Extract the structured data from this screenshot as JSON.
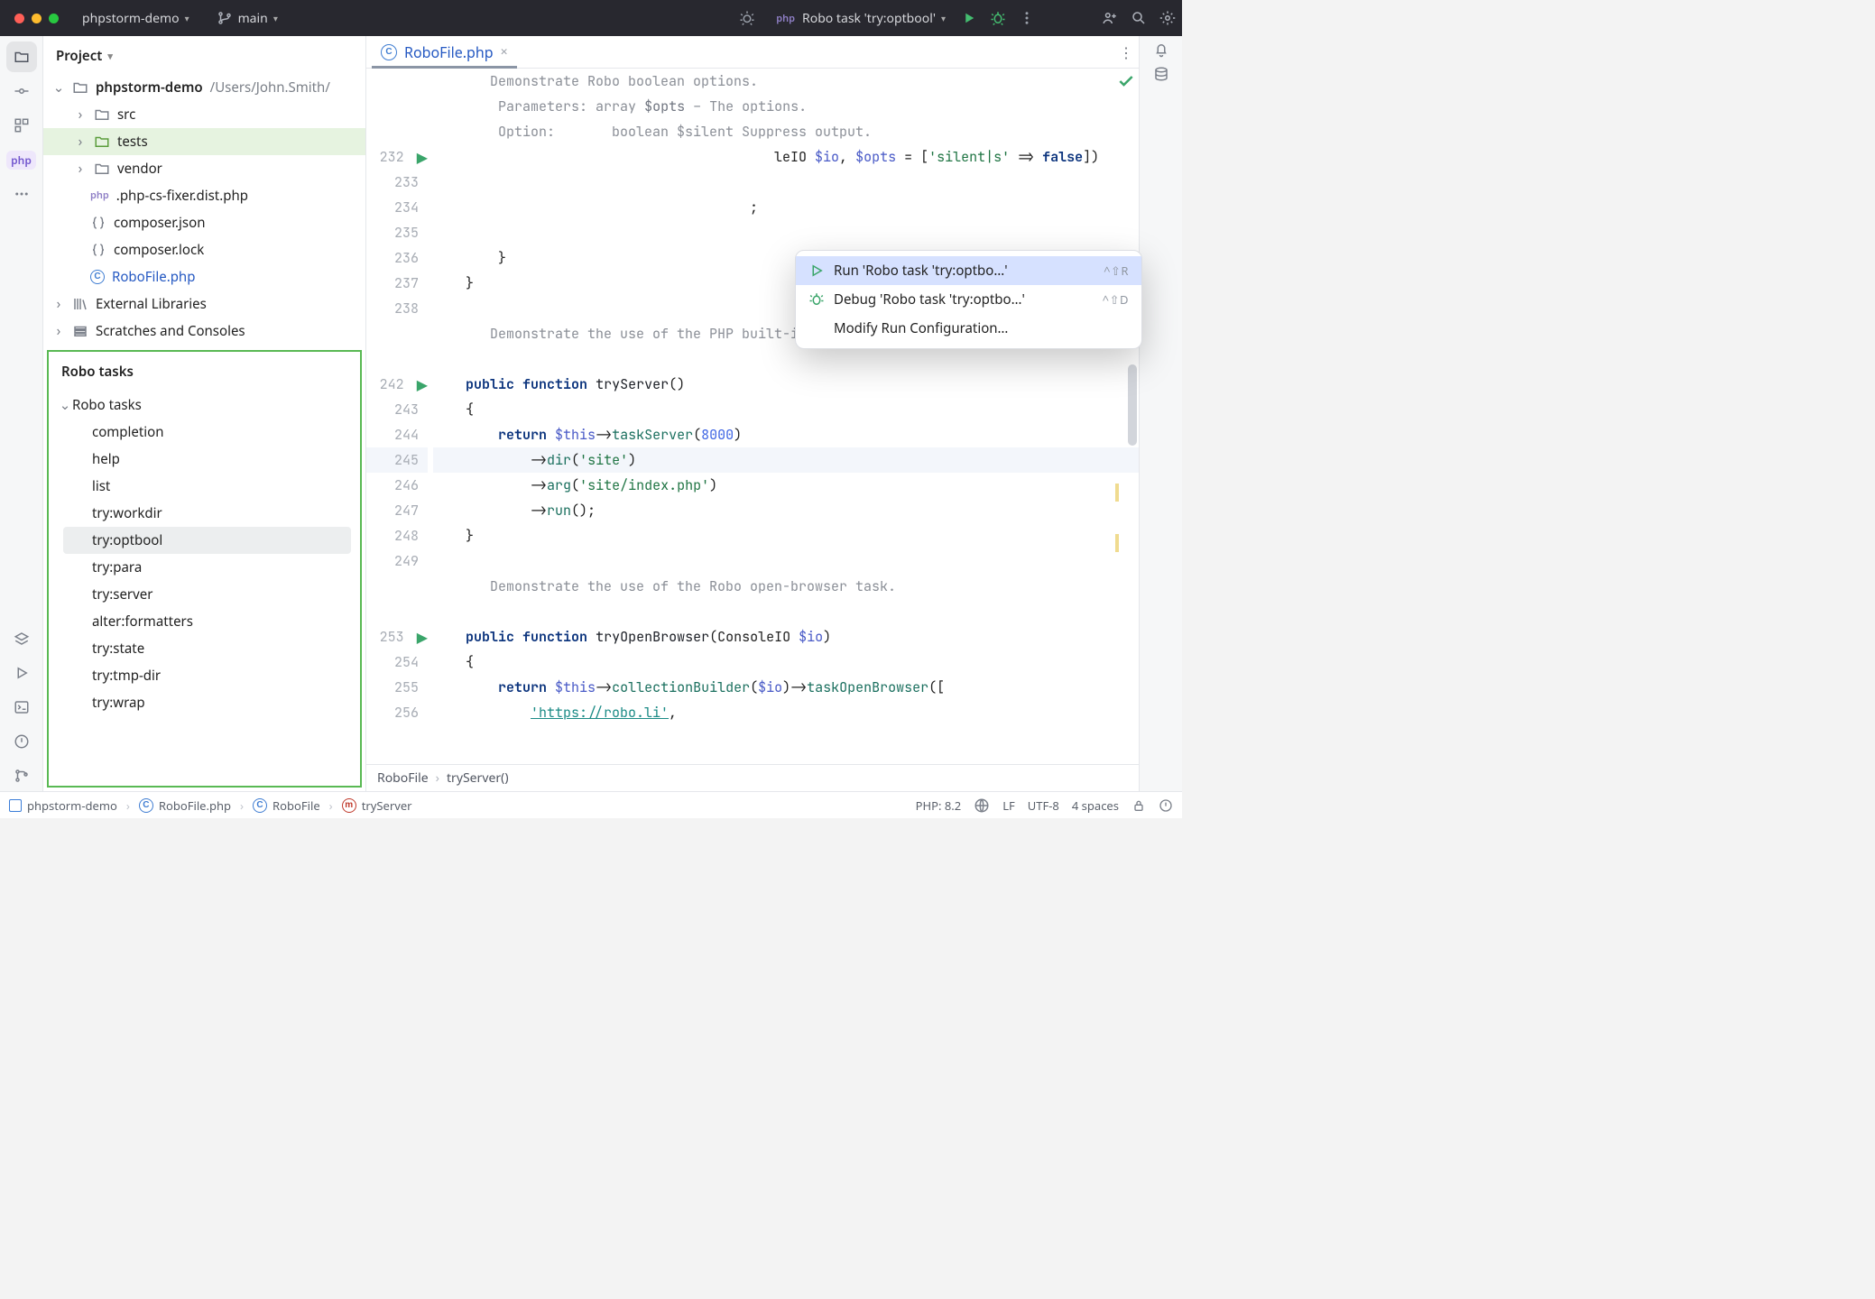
{
  "toolbar": {
    "project": "phpstorm-demo",
    "branch": "main",
    "runconfig": "Robo task 'try:optbool'"
  },
  "sidepanel": {
    "title": "Project"
  },
  "tree": {
    "root": "phpstorm-demo",
    "root_path": "/Users/John.Smith/",
    "children": [
      {
        "name": "src"
      },
      {
        "name": "tests"
      },
      {
        "name": "vendor"
      },
      {
        "name": ".php-cs-fixer.dist.php",
        "type": "php"
      },
      {
        "name": "composer.json",
        "type": "json"
      },
      {
        "name": "composer.lock",
        "type": "json"
      },
      {
        "name": "RoboFile.php",
        "type": "class"
      }
    ],
    "ext_lib": "External Libraries",
    "scratches": "Scratches and Consoles"
  },
  "robo": {
    "title": "Robo tasks",
    "root": "Robo tasks",
    "items": [
      "completion",
      "help",
      "list",
      "try:workdir",
      "try:optbool",
      "try:para",
      "try:server",
      "alter:formatters",
      "try:state",
      "try:tmp-dir",
      "try:wrap"
    ],
    "selected": 4
  },
  "tabs": {
    "active": "RoboFile.php"
  },
  "editor": {
    "doc1": "Demonstrate Robo boolean options.",
    "doc2a": "Parameters:",
    "doc2b": "array",
    "doc2c": "$opts",
    "doc2d": "– The options.",
    "doc3a": "Option:",
    "doc3b": "boolean $silent Suppress output.",
    "line232": {
      "a": "leIO ",
      "b": "$io",
      "c": ", ",
      "d": "$opts",
      "e": " = [",
      "f": "'silent|s'",
      "g": " => ",
      "h": "false",
      "i": "])"
    },
    "doc4": "Demonstrate the use of the PHP built-in webserver.",
    "line242": {
      "a": "public",
      "b": "function",
      "c": "tryServer",
      "d": "()"
    },
    "line243": "{",
    "line244": {
      "a": "return",
      "b": "$this",
      "c": "->",
      "d": "taskServer",
      "e": "(",
      "f": "8000",
      "g": ")"
    },
    "line245": {
      "a": "->",
      "b": "dir",
      "c": "(",
      "d": "'site'",
      "e": ")"
    },
    "line246": {
      "a": "->",
      "b": "arg",
      "c": "(",
      "d": "'site/index.php'",
      "e": ")"
    },
    "line247": {
      "a": "->",
      "b": "run",
      "c": "();"
    },
    "line248": "}",
    "doc5": "Demonstrate the use of the Robo open-browser task.",
    "line253": {
      "a": "public",
      "b": "function",
      "c": "tryOpenBrowser",
      "d": "(ConsoleIO ",
      "e": "$io",
      "f": ")"
    },
    "line254": "{",
    "line255": {
      "a": "return",
      "b": "$this",
      "c": "->",
      "d": "collectionBuilder",
      "e": "(",
      "f": "$io",
      "g": ")->",
      "h": "taskOpenBrowser",
      "i": "(["
    },
    "line256": {
      "a": "'https://robo.li'",
      "b": ","
    },
    "gutters": [
      "232",
      "233",
      "234",
      "235",
      "236",
      "237",
      "238",
      "",
      "",
      "242",
      "243",
      "244",
      "245",
      "246",
      "247",
      "248",
      "249",
      "",
      "",
      "253",
      "254",
      "255",
      "256"
    ]
  },
  "ctx": {
    "run": "Run 'Robo task 'try:optbo…'",
    "run_sc": "^⇧R",
    "debug": "Debug 'Robo task 'try:optbo…'",
    "debug_sc": "^⇧D",
    "modify": "Modify Run Configuration…"
  },
  "breadcrumb": {
    "file": "RoboFile",
    "method": "tryServer()"
  },
  "status": {
    "project": "phpstorm-demo",
    "file": "RoboFile.php",
    "class": "RoboFile",
    "method": "tryServer",
    "php": "PHP: 8.2",
    "le": "LF",
    "enc": "UTF-8",
    "indent": "4 spaces"
  }
}
